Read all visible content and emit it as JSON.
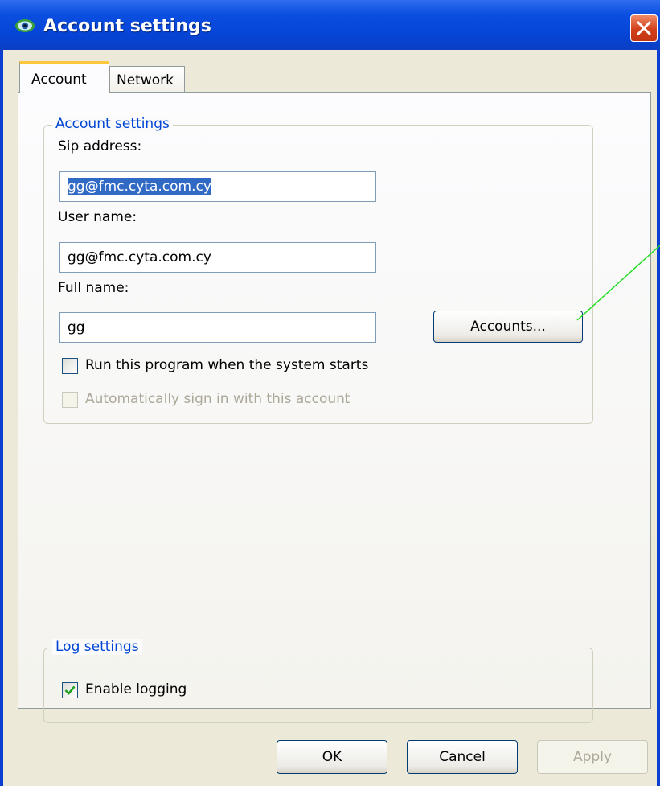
{
  "window": {
    "title": "Account settings"
  },
  "tabs": [
    {
      "label": "Account"
    },
    {
      "label": "Network"
    }
  ],
  "account_group": {
    "legend": "Account settings",
    "sip_address_label": "Sip address:",
    "sip_address_value": "gg@fmc.cyta.com.cy",
    "user_name_label": "User name:",
    "user_name_value": "gg@fmc.cyta.com.cy",
    "full_name_label": "Full name:",
    "full_name_value": "gg",
    "accounts_button": "Accounts...",
    "run_on_startup_label": "Run this program when the system starts",
    "run_on_startup_checked": false,
    "auto_sign_in_label": "Automatically sign in with this account",
    "auto_sign_in_checked": false
  },
  "log_group": {
    "legend": "Log settings",
    "enable_logging_label": "Enable logging",
    "enable_logging_checked": true
  },
  "buttons": {
    "ok": "OK",
    "cancel": "Cancel",
    "apply": "Apply"
  },
  "colors": {
    "titlebar": "#0644d6",
    "legend_text": "#0046d5",
    "selection": "#316ac5",
    "annotation_line": "#22dd22",
    "close_button": "#d2401c"
  }
}
